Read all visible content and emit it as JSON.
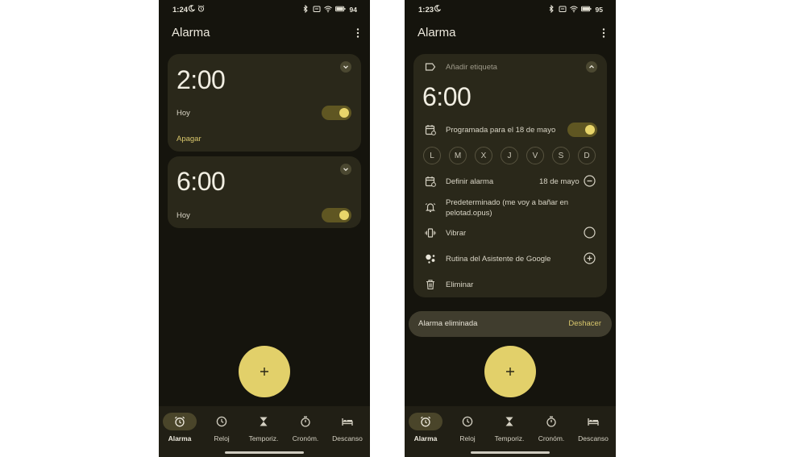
{
  "left": {
    "status": {
      "time": "1:24",
      "battery": "94"
    },
    "title": "Alarma",
    "alarms": [
      {
        "time": "2:00",
        "day": "Hoy",
        "action": "Apagar",
        "enabled": true
      },
      {
        "time": "6:00",
        "day": "Hoy",
        "enabled": true
      }
    ]
  },
  "right": {
    "status": {
      "time": "1:23",
      "battery": "95"
    },
    "title": "Alarma",
    "expanded": {
      "label_placeholder": "Añadir etiqueta",
      "time": "6:00",
      "scheduled": "Programada para el 18 de mayo",
      "enabled": true,
      "days": [
        "L",
        "M",
        "X",
        "J",
        "V",
        "S",
        "D"
      ],
      "set_alarm_label": "Definir alarma",
      "set_alarm_date": "18 de mayo",
      "sound": "Predeterminado (me voy a bañar en pelotad.opus)",
      "vibrate": "Vibrar",
      "assistant": "Rutina del Asistente de Google",
      "delete": "Eliminar"
    },
    "snackbar": {
      "message": "Alarma eliminada",
      "action": "Deshacer"
    }
  },
  "nav": [
    "Alarma",
    "Reloj",
    "Temporiz.",
    "Cronóm.",
    "Descanso"
  ],
  "colors": {
    "background": "#15140d",
    "card": "#2a281a",
    "accent": "#e2d06a",
    "link": "#d9c76c"
  },
  "icons": [
    "moon-icon",
    "alarm-icon",
    "bluetooth-icon",
    "wifi-icon",
    "battery-icon",
    "more-vert-icon",
    "chevron-down-icon",
    "chevron-up-icon",
    "label-icon",
    "calendar-icon",
    "bell-icon",
    "vibrate-icon",
    "assistant-icon",
    "delete-icon",
    "add-icon",
    "clock-icon",
    "hourglass-icon",
    "stopwatch-icon",
    "bed-icon"
  ]
}
